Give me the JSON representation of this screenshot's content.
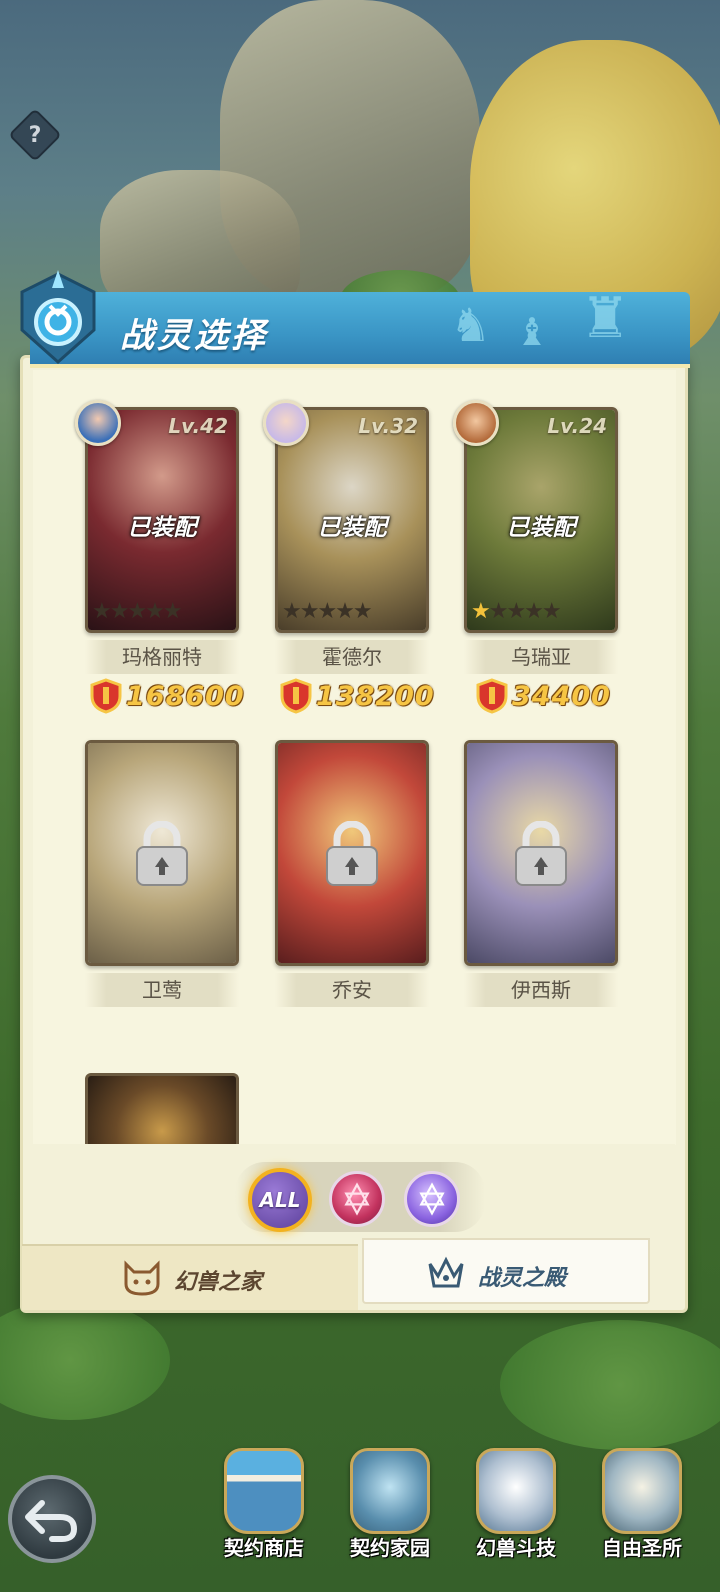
{
  "header": {
    "title": "战灵选择",
    "help_icon": "?"
  },
  "heroes": [
    {
      "name": "玛格丽特",
      "level": "Lv.42",
      "status": "已装配",
      "power": "168600",
      "stars": 0,
      "locked": false,
      "art_color": "#5a1f22"
    },
    {
      "name": "霍德尔",
      "level": "Lv.32",
      "status": "已装配",
      "power": "138200",
      "stars": 0,
      "locked": false,
      "art_color": "#8a7a55"
    },
    {
      "name": "乌瑞亚",
      "level": "Lv.24",
      "status": "已装配",
      "power": "34400",
      "stars": 1,
      "locked": false,
      "art_color": "#5f6e38"
    },
    {
      "name": "卫莺",
      "locked": true,
      "art_color": "#9a8a6a"
    },
    {
      "name": "乔安",
      "locked": true,
      "art_color": "#b0463a"
    },
    {
      "name": "伊西斯",
      "locked": true,
      "art_color": "#7a7aa8"
    }
  ],
  "filters": {
    "all_label": "ALL"
  },
  "tabs": {
    "left": "幻兽之家",
    "right": "战灵之殿"
  },
  "dock": {
    "shop": "契约商店",
    "home": "契约家园",
    "arena": "幻兽斗技",
    "sanctuary": "自由圣所"
  }
}
